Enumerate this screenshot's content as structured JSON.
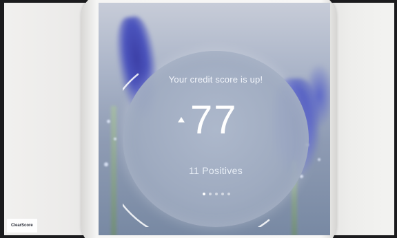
{
  "card": {
    "heading": "Your credit score is up!",
    "score_change": "77",
    "positives": "11 Positives",
    "page_count": 5,
    "active_page": 1
  },
  "watermark": {
    "text": "ClearScore"
  },
  "colors": {
    "accent_white": "#ffffff",
    "card_tint": "#a5b1c6",
    "flower_blue": "#4b54bd"
  },
  "icons": {
    "change_direction": "up-triangle-icon"
  }
}
